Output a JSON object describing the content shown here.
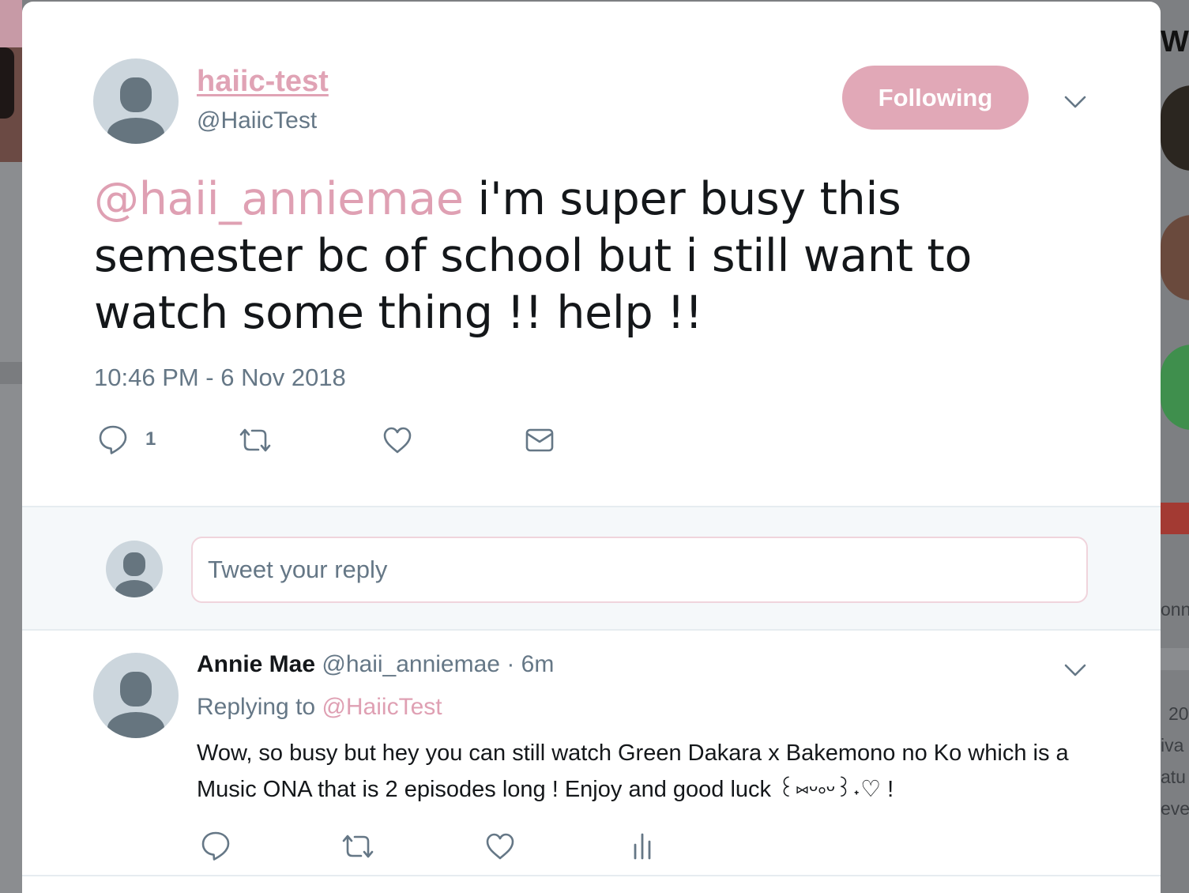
{
  "tweet": {
    "author_name": "haiic-test",
    "author_handle": "@HaiicTest",
    "follow_label": "Following",
    "mention": "@haii_anniemae",
    "text": " i'm super busy this semester bc of school but i still want to watch some thing !! help !!",
    "timestamp": "10:46 PM - 6 Nov 2018",
    "reply_count": "1"
  },
  "composer": {
    "placeholder": "Tweet your reply"
  },
  "reply": {
    "name": "Annie Mae",
    "handle": "@haii_anniemae",
    "time": " · 6m",
    "replying_label": "Replying to ",
    "replying_to": "@HaiicTest",
    "text": "Wow, so busy but hey you can still watch Green Dakara x Bakemono no Ko which is a Music ONA that is 2 episodes long ! Enjoy and good luck ꒰⑅ᵕ༚ᵕ꒱˖♡ !"
  },
  "background": {
    "right_heading_fragment": "Wh",
    "right_fragments": [
      "onn",
      "20",
      "iva",
      "atu",
      "eve"
    ]
  },
  "colors": {
    "accent": "#e0a3b5",
    "follow_button": "#e1a8b7",
    "secondary_text": "#657786",
    "primary_text": "#14171a",
    "avatar_bg": "#ccd6dd",
    "avatar_fg": "#66757f"
  },
  "icons": {
    "reply": "speech-bubble-icon",
    "retweet": "retweet-icon",
    "like": "heart-icon",
    "dm": "envelope-icon",
    "analytics": "analytics-bars-icon",
    "menu": "chevron-down-icon"
  }
}
